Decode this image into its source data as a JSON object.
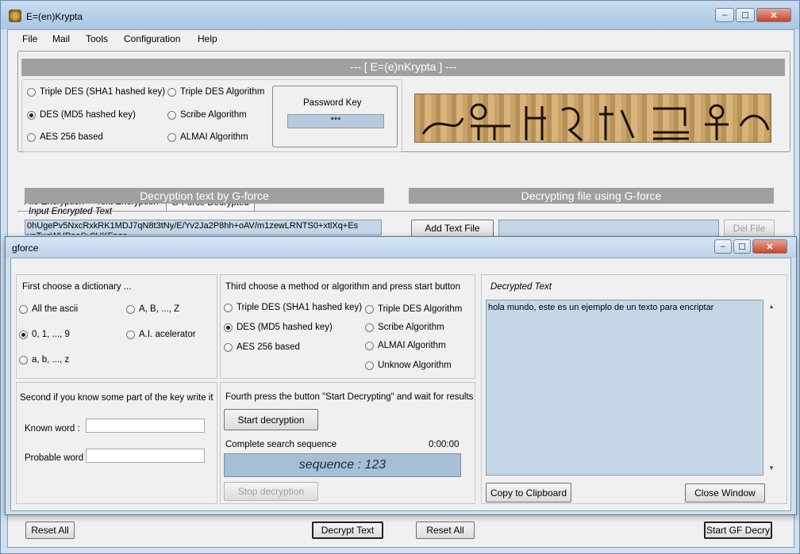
{
  "main_window": {
    "title": "E=(en)Krypta",
    "menu": [
      "File",
      "Mail",
      "Tools",
      "Configuration",
      "Help"
    ],
    "banner": "--- [  E=(e)nKrypta  ] ---",
    "algorithms_left": [
      {
        "label": "Triple DES (SHA1 hashed key)",
        "checked": false
      },
      {
        "label": "DES (MD5 hashed key)",
        "checked": true
      },
      {
        "label": "AES 256 based",
        "checked": false
      }
    ],
    "algorithms_right": [
      {
        "label": "Triple DES Algorithm",
        "checked": false
      },
      {
        "label": "Scribe Algorithm",
        "checked": false
      },
      {
        "label": "ALMAI Algorithm",
        "checked": false
      }
    ],
    "password_label": "Password Key",
    "password_value": "***",
    "tabs": [
      "File Encryption",
      "Text Encryption",
      "G-Force Decrypted"
    ],
    "left_banner": "Decryption text by G-force",
    "input_label": "Input Encrypted Text",
    "input_text": "0hUgePv5NxcRxkRK1MDJ7qN8t3tNy/E/Yv2Ja2P8hh+oAV/m1zewLRNTS0+xtlXq+Es\nvnTucWUPaaSy9HKFpaa",
    "right_banner": "Decrypting file using G-force",
    "add_file_button": "Add Text File",
    "del_file_button": "Del File",
    "reset_all_left": "Reset All",
    "decrypt_text_button": "Decrypt Text",
    "reset_all_right": "Reset All",
    "start_gf_button": "Start GF Decry"
  },
  "gforce": {
    "title": "gforce",
    "dictionary_title": "First choose a dictionary ...",
    "dictionaries_left": [
      {
        "label": "All the ascii",
        "checked": false
      },
      {
        "label": "0, 1, ..., 9",
        "checked": true
      },
      {
        "label": "a, b, ..., z",
        "checked": false
      }
    ],
    "dictionaries_right": [
      {
        "label": "A, B, ..., Z",
        "checked": false
      },
      {
        "label": "A.I. acelerator",
        "checked": false
      }
    ],
    "method_title": "Third choose a method or algorithm and press start button",
    "methods_left": [
      {
        "label": "Triple DES (SHA1 hashed key)",
        "checked": false
      },
      {
        "label": "DES (MD5 hashed key)",
        "checked": true
      },
      {
        "label": "AES 256 based",
        "checked": false
      }
    ],
    "methods_right": [
      {
        "label": "Triple DES Algorithm",
        "checked": false
      },
      {
        "label": "Scribe Algorithm",
        "checked": false
      },
      {
        "label": "ALMAI Algorithm",
        "checked": false
      },
      {
        "label": "Unknow Algorithm",
        "checked": false
      }
    ],
    "known_key_title": "Second if you know some part of the key write it",
    "known_word_label": "Known word :",
    "known_word_value": "",
    "probable_word_label": "Probable word :",
    "probable_word_value": "",
    "fourth_title": "Fourth press the button \"Start Decrypting\" and wait for results",
    "start_button": "Start decryption",
    "sequence_label": "Complete search sequence",
    "elapsed": "0:00:00",
    "sequence_display": "sequence : 123",
    "stop_button": "Stop decryption",
    "decrypted_label": "Decrypted Text",
    "decrypted_text": "hola mundo, este es un ejemplo de un texto para encriptar",
    "copy_button": "Copy to Clipboard",
    "close_button": "Close Window"
  }
}
